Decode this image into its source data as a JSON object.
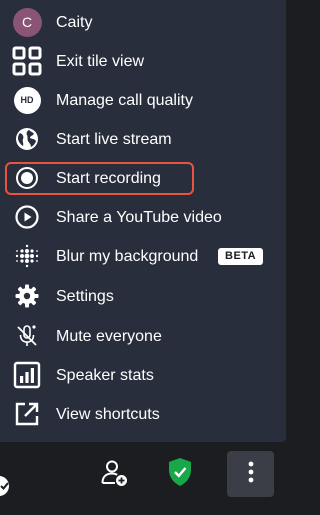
{
  "menu": {
    "items": [
      {
        "id": "participant",
        "label": "Caity",
        "icon": "avatar",
        "avatar_initial": "C",
        "avatar_color": "#8a5477"
      },
      {
        "id": "tile-view",
        "label": "Exit tile view",
        "icon": "grid-icon"
      },
      {
        "id": "call-quality",
        "label": "Manage call quality",
        "icon": "hd-icon",
        "badge_text": "HD"
      },
      {
        "id": "live-stream",
        "label": "Start live stream",
        "icon": "globe-icon"
      },
      {
        "id": "recording",
        "label": "Start recording",
        "icon": "record-icon"
      },
      {
        "id": "youtube",
        "label": "Share a YouTube video",
        "icon": "play-circle-icon"
      },
      {
        "id": "blur",
        "label": "Blur my background",
        "icon": "dots-grid-icon",
        "tag": "BETA"
      },
      {
        "id": "settings",
        "label": "Settings",
        "icon": "gear-icon"
      },
      {
        "id": "mute-all",
        "label": "Mute everyone",
        "icon": "mic-off-icon"
      },
      {
        "id": "speaker-stats",
        "label": "Speaker stats",
        "icon": "bar-chart-icon"
      },
      {
        "id": "shortcuts",
        "label": "View shortcuts",
        "icon": "external-link-icon"
      }
    ]
  },
  "toolbar": {
    "buttons": [
      {
        "id": "partial",
        "icon": "check-circle-icon"
      },
      {
        "id": "invite",
        "icon": "add-user-icon"
      },
      {
        "id": "security",
        "icon": "shield-check-icon",
        "color": "#18a84a"
      },
      {
        "id": "more",
        "icon": "more-vertical-icon"
      }
    ]
  },
  "colors": {
    "menu_bg": "#292e3c",
    "page_bg": "#1c1d21",
    "highlight": "#e8543f",
    "accent_green": "#18a84a"
  }
}
